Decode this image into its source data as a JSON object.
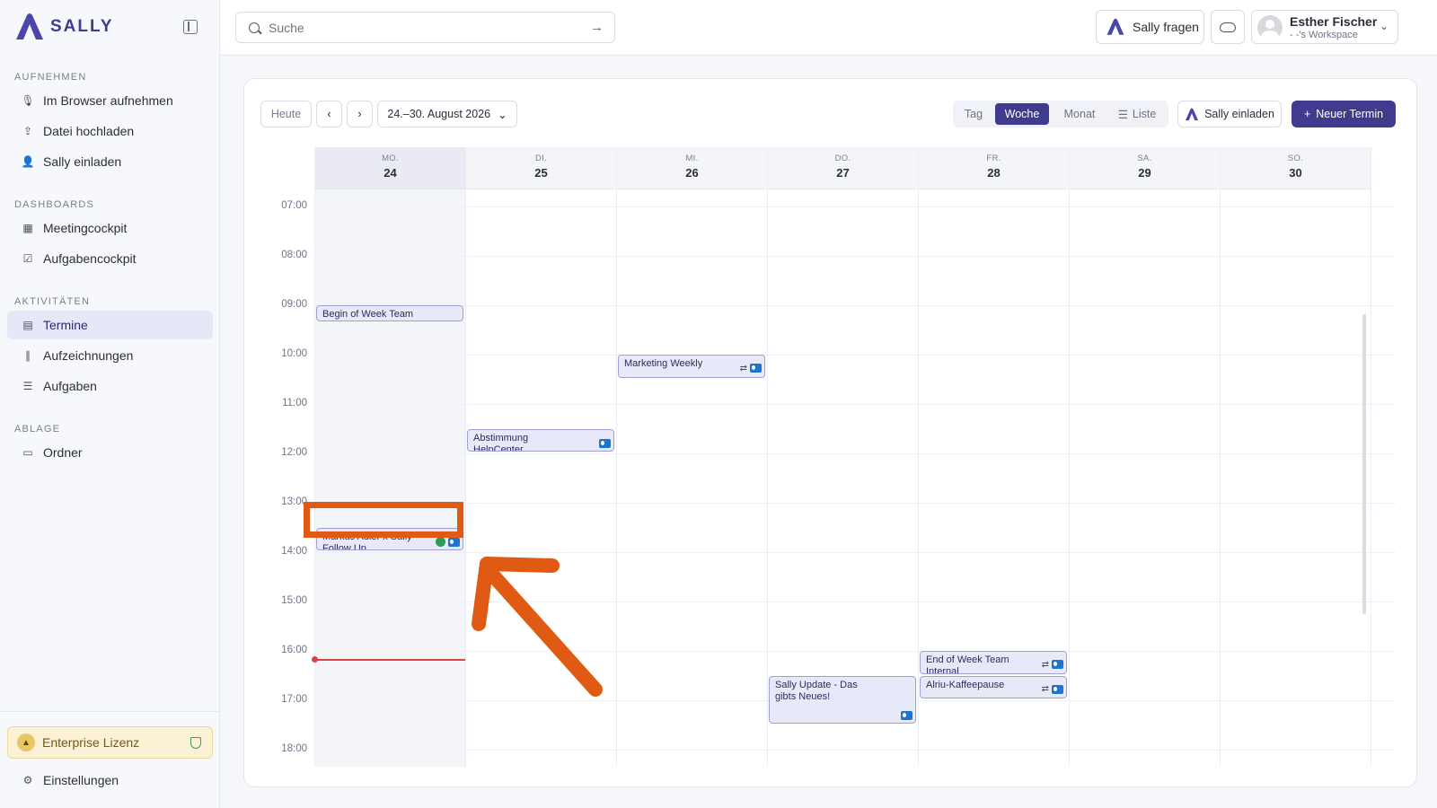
{
  "app": {
    "brand": "SALLY"
  },
  "sidebar": {
    "sections": [
      {
        "title": "AUFNEHMEN",
        "items": [
          {
            "label": "Im Browser aufnehmen",
            "icon": "microphone-icon"
          },
          {
            "label": "Datei hochladen",
            "icon": "upload-icon"
          },
          {
            "label": "Sally einladen",
            "icon": "user-plus-icon"
          }
        ]
      },
      {
        "title": "DASHBOARDS",
        "items": [
          {
            "label": "Meetingcockpit",
            "icon": "grid-icon"
          },
          {
            "label": "Aufgabencockpit",
            "icon": "checkbox-icon"
          }
        ]
      },
      {
        "title": "AKTIVITÄTEN",
        "items": [
          {
            "label": "Termine",
            "icon": "calendar-icon",
            "active": true
          },
          {
            "label": "Aufzeichnungen",
            "icon": "waveform-icon"
          },
          {
            "label": "Aufgaben",
            "icon": "checklist-icon"
          }
        ]
      },
      {
        "title": "ABLAGE",
        "items": [
          {
            "label": "Ordner",
            "icon": "folder-icon"
          }
        ]
      }
    ],
    "license_label": "Enterprise Lizenz",
    "settings_label": "Einstellungen"
  },
  "topbar": {
    "search_placeholder": "Suche",
    "ask_label": "Sally fragen",
    "user_name": "Esther Fischer",
    "workspace": "- -'s Workspace"
  },
  "toolbar": {
    "today_label": "Heute",
    "range_label": "24.–30. August 2026",
    "views": [
      "Tag",
      "Woche",
      "Monat",
      "Liste"
    ],
    "active_view": "Woche",
    "invite_label": "Sally einladen",
    "new_event_label": "Neuer Termin"
  },
  "calendar": {
    "days": [
      {
        "dow": "MO.",
        "num": "24",
        "today": true
      },
      {
        "dow": "DI.",
        "num": "25"
      },
      {
        "dow": "MI.",
        "num": "26"
      },
      {
        "dow": "DO.",
        "num": "27"
      },
      {
        "dow": "FR.",
        "num": "28"
      },
      {
        "dow": "SA.",
        "num": "29"
      },
      {
        "dow": "SO.",
        "num": "30"
      }
    ],
    "hours": [
      "07:00",
      "08:00",
      "09:00",
      "10:00",
      "11:00",
      "12:00",
      "13:00",
      "14:00",
      "15:00",
      "16:00",
      "17:00",
      "18:00"
    ],
    "events": [
      {
        "title": "Begin of Week Team Internal",
        "day": 0,
        "start": "09:00",
        "end": "09:20"
      },
      {
        "title": "Marketing Weekly",
        "day": 2,
        "start": "10:00",
        "end": "10:30",
        "icons": [
          "repeat",
          "outlook"
        ]
      },
      {
        "title": "Abstimmung HelpCenter",
        "day": 1,
        "start": "11:30",
        "end": "12:00",
        "icons": [
          "outlook"
        ]
      },
      {
        "title": "Markus Adler x Sally Follow Up",
        "day": 0,
        "start": "13:30",
        "end": "14:00",
        "icons": [
          "sally",
          "outlook"
        ]
      },
      {
        "title": "End of Week Team Internal",
        "day": 4,
        "start": "16:00",
        "end": "16:30",
        "icons": [
          "repeat",
          "outlook"
        ]
      },
      {
        "title": "Alriu-Kaffeepause",
        "day": 4,
        "start": "16:30",
        "end": "17:00",
        "icons": [
          "repeat",
          "outlook"
        ]
      },
      {
        "title": "Sally Update - Das gibts Neues!",
        "day": 3,
        "start": "16:30",
        "end": "17:30",
        "icons": [
          "outlook"
        ]
      }
    ],
    "now": "16:10"
  },
  "colors": {
    "accent": "#3f3c8f",
    "now": "#d64545",
    "annotation": "#e15a14"
  }
}
